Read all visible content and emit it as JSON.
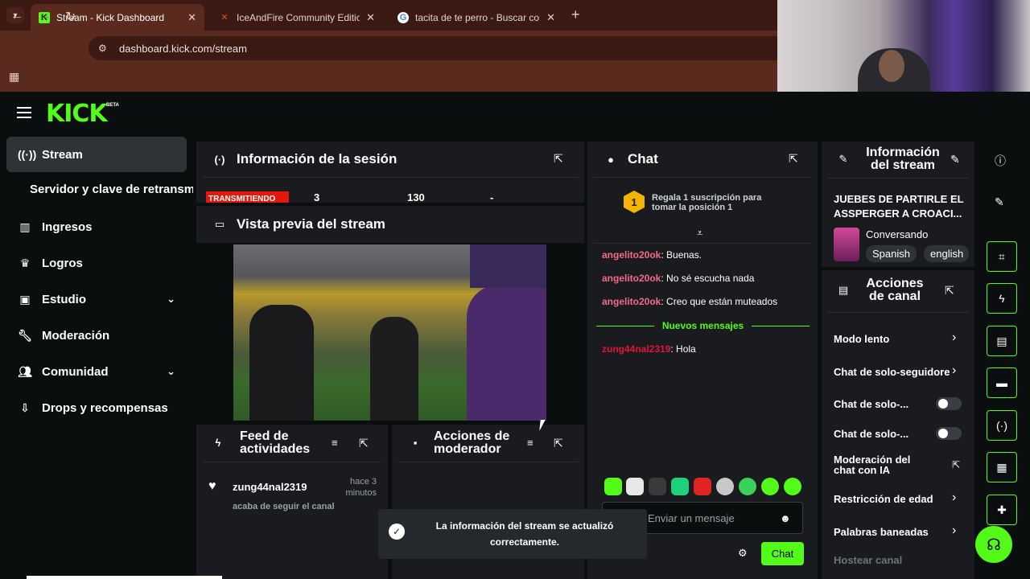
{
  "browser": {
    "tabs": [
      {
        "title": "Stream - Kick Dashboard",
        "favicon": "K",
        "color": "#53fc18"
      },
      {
        "title": "IceAndFire Community Edition",
        "favicon": "✕",
        "color": "#e34b2a"
      },
      {
        "title": "tacita de te perro - Buscar con G",
        "favicon": "G",
        "color": "#4285f4"
      }
    ],
    "url": "dashboard.kick.com/stream"
  },
  "app": {
    "logo": "KICK",
    "beta": "BETA",
    "accent": "#53fc18"
  },
  "sidebar": {
    "items": [
      {
        "label": "Stream",
        "icon": "broadcast-icon"
      },
      {
        "label": "Ingresos",
        "icon": "chart-icon"
      },
      {
        "label": "Logros",
        "icon": "trophy-icon"
      },
      {
        "label": "Estudio",
        "icon": "studio-icon"
      },
      {
        "label": "Moderación",
        "icon": "wrench-icon"
      },
      {
        "label": "Comunidad",
        "icon": "users-icon"
      },
      {
        "label": "Drops y recompensas",
        "icon": "drops-icon"
      }
    ],
    "sub_item": "Servidor y clave de retransmisión"
  },
  "session": {
    "title": "Información de la sesión",
    "status": "TRANSMITIENDO",
    "col1": "3",
    "col2": "130",
    "col3": "-"
  },
  "preview": {
    "title": "Vista previa del stream"
  },
  "activity": {
    "title": "Feed de actividades",
    "user": "zung44nal2319",
    "action": "acaba de seguir el canal",
    "time": "hace 3 minutos"
  },
  "mod_actions": {
    "title": "Acciones de moderador"
  },
  "chat": {
    "title": "Chat",
    "gift_rank": "1",
    "gift_text": "Regala 1 suscripción para tomar la posición 1",
    "messages": [
      {
        "user": "angelito20ok",
        "text": ": Buenas."
      },
      {
        "user": "angelito20ok",
        "text": ": No sé escucha nada"
      },
      {
        "user": "angelito20ok",
        "text": ": Creo que están muteados"
      }
    ],
    "new_messages_label": "Nuevos mensajes",
    "new_message": {
      "user": "zung44nal2319",
      "text": ": Hola"
    },
    "input_placeholder": "Enviar un mensaje",
    "send_label": "Chat"
  },
  "stream_info": {
    "title": "Información del stream",
    "stream_title": "JUEBES DE PARTIRLE EL ASSPERGER A CROACI...",
    "category": "Conversando",
    "tags": [
      "Spanish",
      "english"
    ]
  },
  "channel_actions": {
    "title": "Acciones de canal",
    "items": [
      {
        "label": "Modo lento"
      },
      {
        "label": "Chat de solo-seguidores"
      },
      {
        "label": "Chat de solo-..."
      },
      {
        "label": "Chat de solo-..."
      },
      {
        "label": "Moderación del chat con IA"
      },
      {
        "label": "Restricción de edad"
      },
      {
        "label": "Palabras baneadas"
      },
      {
        "label": "Hostear canal"
      }
    ]
  },
  "toast": {
    "message": "La información del stream se actualizó correctamente."
  }
}
